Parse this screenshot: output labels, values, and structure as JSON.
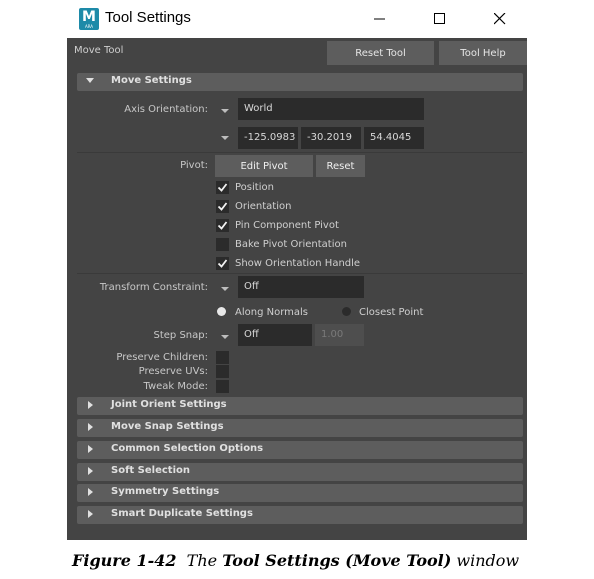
{
  "window": {
    "logo_letter": "M",
    "logo_sub": "ARA",
    "title": "Tool Settings"
  },
  "header": {
    "tool_name": "Move Tool",
    "reset_tool": "Reset Tool",
    "tool_help": "Tool Help"
  },
  "move_settings": {
    "section_label": "Move Settings",
    "axis_orientation_label": "Axis Orientation:",
    "axis_orientation_value": "World",
    "coords": [
      "-125.0983",
      "-30.2019",
      "54.4045"
    ],
    "pivot_label": "Pivot:",
    "edit_pivot": "Edit Pivot",
    "reset": "Reset",
    "pivot_options": [
      {
        "label": "Position",
        "checked": true
      },
      {
        "label": "Orientation",
        "checked": true
      },
      {
        "label": "Pin Component Pivot",
        "checked": true
      },
      {
        "label": "Bake Pivot Orientation",
        "checked": false
      },
      {
        "label": "Show Orientation Handle",
        "checked": true
      }
    ],
    "transform_constraint_label": "Transform Constraint:",
    "transform_constraint_value": "Off",
    "along_normals": "Along Normals",
    "closest_point": "Closest Point",
    "step_snap_label": "Step Snap:",
    "step_snap_value": "Off",
    "step_snap_amount": "1.00",
    "preserve_children": "Preserve Children:",
    "preserve_uvs": "Preserve UVs:",
    "tweak_mode": "Tweak Mode:"
  },
  "collapsed_sections": [
    "Joint Orient Settings",
    "Move Snap Settings",
    "Common Selection Options",
    "Soft Selection",
    "Symmetry Settings",
    "Smart Duplicate Settings"
  ],
  "caption": {
    "figure": "Figure 1-42",
    "the": "The",
    "title": "Tool Settings (Move Tool)",
    "window": "window"
  },
  "colors": {
    "panel": "#444444",
    "section": "#5d5d5d",
    "field": "#2b2b2b",
    "logo": "#1d8aa8"
  }
}
